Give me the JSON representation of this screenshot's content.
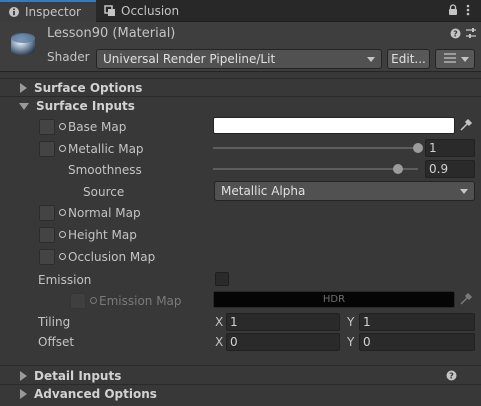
{
  "tabs": [
    {
      "label": "Inspector",
      "icon": "info-icon",
      "active": true
    },
    {
      "label": "Occlusion",
      "icon": "occlusion-icon",
      "active": false
    }
  ],
  "material": {
    "name": "Lesson90 (Material)",
    "shader_label": "Shader",
    "shader_value": "Universal Render Pipeline/Lit",
    "edit_label": "Edit..."
  },
  "sections": {
    "surface_options": "Surface Options",
    "surface_inputs": "Surface Inputs",
    "detail_inputs": "Detail Inputs",
    "advanced_options": "Advanced Options"
  },
  "inputs": {
    "base_map": "Base Map",
    "base_color": "#ffffff",
    "metallic_map": "Metallic Map",
    "metallic_value": "1",
    "metallic_fraction": 1.0,
    "smoothness": "Smoothness",
    "smoothness_value": "0.9",
    "smoothness_fraction": 0.9,
    "source": "Source",
    "source_value": "Metallic Alpha",
    "normal_map": "Normal Map",
    "height_map": "Height Map",
    "occlusion_map": "Occlusion Map",
    "emission": "Emission",
    "emission_map": "Emission Map",
    "emission_hdr": "HDR",
    "tiling": "Tiling",
    "offset": "Offset",
    "tiling_x": "1",
    "tiling_y": "1",
    "offset_x": "0",
    "offset_y": "0",
    "x_label": "X",
    "y_label": "Y"
  },
  "colors": {
    "accent": "#3a79bb",
    "background": "#383838"
  }
}
